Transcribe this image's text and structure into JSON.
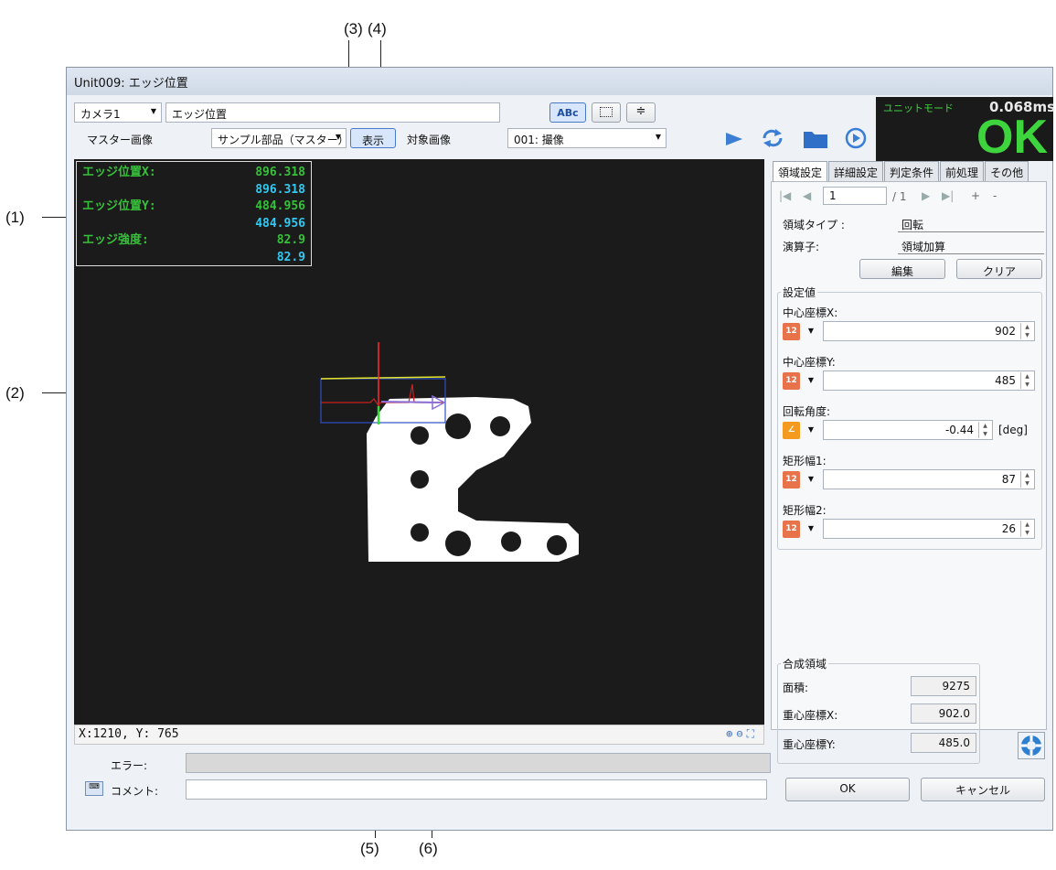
{
  "callouts": {
    "c1": "(1)",
    "c2": "(2)",
    "c3": "(3)",
    "c4": "(4)",
    "c5": "(5)",
    "c6": "(6)"
  },
  "window": {
    "title": "Unit009: エッジ位置"
  },
  "toolbar": {
    "camera_select": "カメラ1",
    "unit_name": "エッジ位置",
    "master_label": "マスター画像",
    "master_select": "サンプル部品（マスター）",
    "show_button": "表示",
    "target_label": "対象画像",
    "target_select": "001: 撮像",
    "abc_button": "ABc"
  },
  "status": {
    "mode": "ユニットモード",
    "time": "0.068ms",
    "result": "OK",
    "result_color": "#3dd43d"
  },
  "overlay": {
    "rows": [
      {
        "label": "エッジ位置X:",
        "value": "896.318",
        "second": "896.318"
      },
      {
        "label": "エッジ位置Y:",
        "value": "484.956",
        "second": "484.956"
      },
      {
        "label": "エッジ強度:",
        "value": "82.9",
        "second": "82.9"
      }
    ]
  },
  "viewer": {
    "coords": "X:1210, Y: 765",
    "error_label": "エラー:",
    "comment_label": "コメント:"
  },
  "tabs": [
    "領域設定",
    "詳細設定",
    "判定条件",
    "前処理",
    "その他"
  ],
  "nav": {
    "page": "1",
    "total": "/ 1",
    "add": "+",
    "remove": "-"
  },
  "region": {
    "type_label": "領域タイプ :",
    "type_value": "回転",
    "op_label": "演算子:",
    "op_value": "領域加算",
    "edit_button": "編集",
    "clear_button": "クリア"
  },
  "settings": {
    "group_title": "設定値",
    "fields": [
      {
        "label": "中心座標X:",
        "value": "902",
        "unit": ""
      },
      {
        "label": "中心座標Y:",
        "value": "485",
        "unit": ""
      },
      {
        "label": "回転角度:",
        "value": "-0.44",
        "unit": "[deg]"
      },
      {
        "label": "矩形幅1:",
        "value": "87",
        "unit": ""
      },
      {
        "label": "矩形幅2:",
        "value": "26",
        "unit": ""
      }
    ]
  },
  "composite": {
    "group_title": "合成領域",
    "area_label": "面積:",
    "area_value": "9275",
    "cx_label": "重心座標X:",
    "cx_value": "902.0",
    "cy_label": "重心座標Y:",
    "cy_value": "485.0"
  },
  "footer": {
    "ok_button": "OK",
    "cancel_button": "キャンセル"
  }
}
